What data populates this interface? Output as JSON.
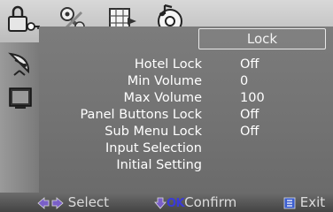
{
  "top_icons": [
    "lock-icon",
    "settings-icon",
    "grid-icon",
    "speaker-icon"
  ],
  "side_icons": [
    "satellite-dish-icon",
    "monitor-icon"
  ],
  "menu": {
    "title": "Lock",
    "items": [
      {
        "label": "Hotel Lock",
        "value": "Off"
      },
      {
        "label": "Min Volume",
        "value": "0"
      },
      {
        "label": "Max Volume",
        "value": "100"
      },
      {
        "label": "Panel Buttons Lock",
        "value": "Off"
      },
      {
        "label": "Sub Menu Lock",
        "value": "Off"
      },
      {
        "label": "Input Selection",
        "value": ""
      },
      {
        "label": "Initial Setting",
        "value": ""
      }
    ]
  },
  "footer": {
    "select_label": "Select",
    "ok_label": "OK",
    "confirm_label": "Confirm",
    "exit_label": "Exit"
  },
  "colors": {
    "arrow_purple": "#7a5fc8",
    "ok_blue": "#3a3ad8",
    "exit_icon_blue": "#3b5ed0"
  }
}
